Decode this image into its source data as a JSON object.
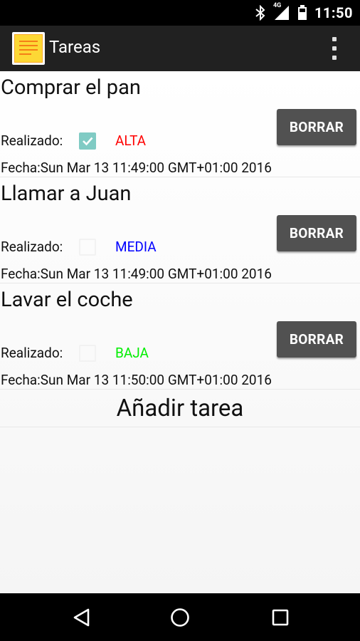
{
  "status_bar": {
    "time": "11:50",
    "network_label": "4G",
    "icons": [
      "bluetooth-icon",
      "signal-icon",
      "battery-icon"
    ]
  },
  "action_bar": {
    "title": "Tareas",
    "logo_icon": "sticky-note-icon",
    "overflow_icon": "more-vert-icon"
  },
  "tasks": [
    {
      "title": "Comprar el pan",
      "done_label": "Realizado:",
      "done": true,
      "priority": "ALTA",
      "priority_color": "#ff0000",
      "date": "Fecha:Sun Mar 13 11:49:00 GMT+01:00 2016",
      "delete_label": "BORRAR"
    },
    {
      "title": "Llamar a Juan",
      "done_label": "Realizado:",
      "done": false,
      "priority": "MEDIA",
      "priority_color": "#0000ff",
      "date": "Fecha:Sun Mar 13 11:49:00 GMT+01:00 2016",
      "delete_label": "BORRAR"
    },
    {
      "title": "Lavar el coche",
      "done_label": "Realizado:",
      "done": false,
      "priority": "BAJA",
      "priority_color": "#00ee00",
      "date": "Fecha:Sun Mar 13 11:50:00 GMT+01:00 2016",
      "delete_label": "BORRAR"
    }
  ],
  "add_task_label": "Añadir tarea",
  "colors": {
    "action_bar_bg": "#212121",
    "button_bg": "#515151",
    "checkbox_checked": "#80cbc4"
  },
  "nav_bar": {
    "icons": [
      "back-icon",
      "home-icon",
      "recents-icon"
    ]
  }
}
